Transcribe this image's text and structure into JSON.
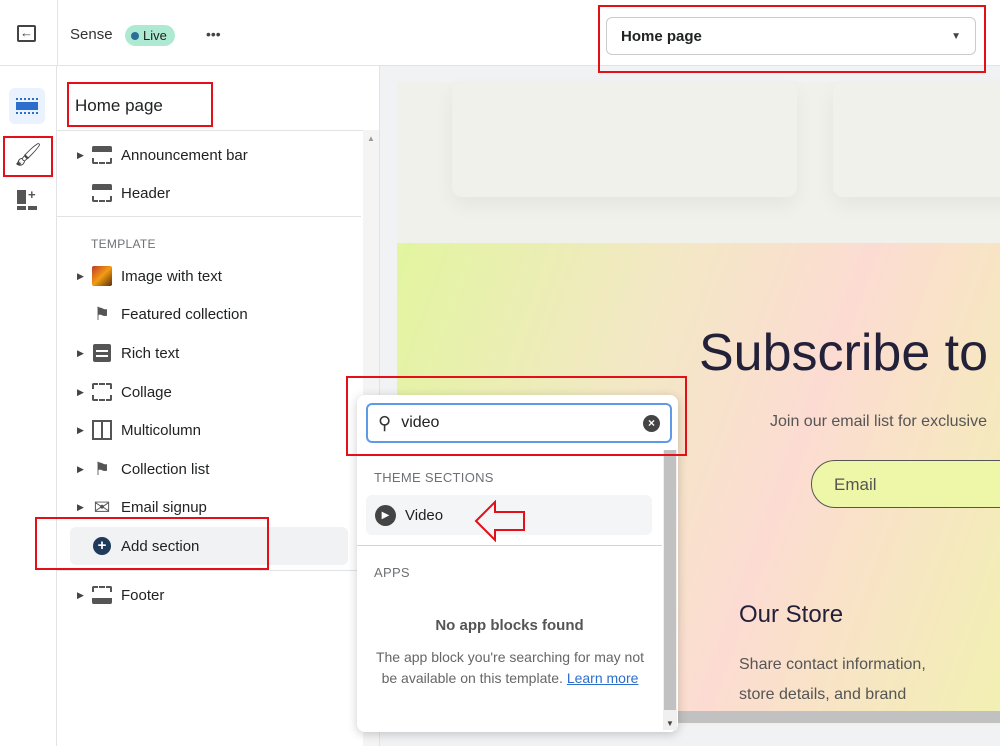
{
  "topbar": {
    "theme_name": "Sense",
    "status_badge": "Live",
    "more_label": "•••",
    "page_selector": "Home page",
    "accent": "#aee9d1"
  },
  "sidebar": {
    "title": "Home page",
    "header_items": [
      {
        "label": "Announcement bar",
        "icon": "section-icon"
      },
      {
        "label": "Header",
        "icon": "section-icon"
      }
    ],
    "template_label": "TEMPLATE",
    "template_items": [
      {
        "label": "Image with text",
        "icon": "image-thumbnail-icon"
      },
      {
        "label": "Featured collection",
        "icon": "tag-icon"
      },
      {
        "label": "Rich text",
        "icon": "text-icon"
      },
      {
        "label": "Collage",
        "icon": "section-icon"
      },
      {
        "label": "Multicolumn",
        "icon": "columns-icon"
      },
      {
        "label": "Collection list",
        "icon": "tag-icon"
      },
      {
        "label": "Email signup",
        "icon": "envelope-icon"
      }
    ],
    "add_section": "Add section",
    "footer_item": "Footer"
  },
  "popup": {
    "search_value": "video",
    "theme_sections_label": "THEME SECTIONS",
    "result": "Video",
    "apps_label": "APPS",
    "empty_title": "No app blocks found",
    "empty_text": "The app block you're searching for may not be available on this template.",
    "learn_more": "Learn more"
  },
  "preview": {
    "heading": "Subscribe to",
    "subtext": "Join our email list for exclusive",
    "email_placeholder": "Email",
    "store_title": "Our Store",
    "store_text_1": "Share contact information,",
    "store_text_2": "store details, and brand"
  }
}
